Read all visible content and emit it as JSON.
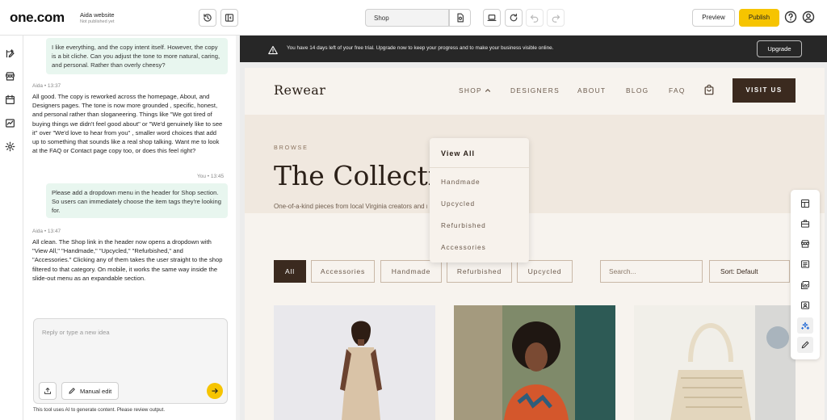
{
  "header": {
    "logo": "one.com",
    "site_name": "Aida website",
    "site_status": "Not published yet",
    "page_select": "Shop",
    "preview_label": "Preview",
    "publish_label": "Publish"
  },
  "chat": {
    "messages": [
      {
        "role": "user",
        "text": "I like everything, and the copy intent itself. However, the copy is a bit cliche. Can you adjust the tone to more natural, caring, and personal. Rather than overly cheesy?"
      },
      {
        "role": "assistant",
        "author": "Aida",
        "time": "13:37",
        "text": "All good. The copy is reworked across the homepage, About, and Designers pages. The tone is now more grounded , specific, honest, and personal rather than sloganeering. Things like \"We got tired of buying things we didn't feel good about\" or \"We'd genuinely like to see it\" over \"We'd love to hear from you\" , smaller word choices that add up to something that sounds like a real shop talking. Want me to look at the FAQ or Contact page copy too, or does this feel right?"
      },
      {
        "role": "user",
        "author": "You",
        "time": "13:45",
        "text": "Please add a dropdown menu in the header for Shop section. So users can immediately choose the item tags they're looking for."
      },
      {
        "role": "assistant",
        "author": "Aida",
        "time": "13:47",
        "text": "All clean. The Shop link in the header now opens a dropdown with \"View All,\" \"Handmade,\" \"Upcycled,\" \"Refurbished,\" and \"Accessories.\" Clicking any of them takes the user straight to the shop filtered to that category. On mobile, it works the same way inside the slide-out menu as an expandable section."
      }
    ],
    "composer_placeholder": "Reply or type a new idea",
    "manual_edit_label": "Manual edit",
    "disclaimer": "This tool uses AI to generate content. Please review output."
  },
  "trial": {
    "text": "You have 14 days left of your free trial. Upgrade now to keep your progress and to make your business visible online.",
    "upgrade_label": "Upgrade"
  },
  "site": {
    "brand": "Rewear",
    "nav": [
      "SHOP",
      "DESIGNERS",
      "ABOUT",
      "BLOG",
      "FAQ"
    ],
    "visit_label": "VISIT US",
    "browse_label": "BROWSE",
    "hero_title": "The Collection",
    "hero_subtitle": "One-of-a-kind pieces from local Virginia creators and makers.",
    "dropdown": [
      "View All",
      "Handmade",
      "Upcycled",
      "Refurbished",
      "Accessories"
    ],
    "filters": [
      "All",
      "Accessories",
      "Handmade",
      "Refurbished",
      "Upcycled"
    ],
    "search_placeholder": "Search...",
    "sort_label": "Sort: Default"
  },
  "colors": {
    "accent": "#f6c400",
    "dark_brown": "#3b2a1f",
    "chat_bubble": "#e8f6ef"
  }
}
